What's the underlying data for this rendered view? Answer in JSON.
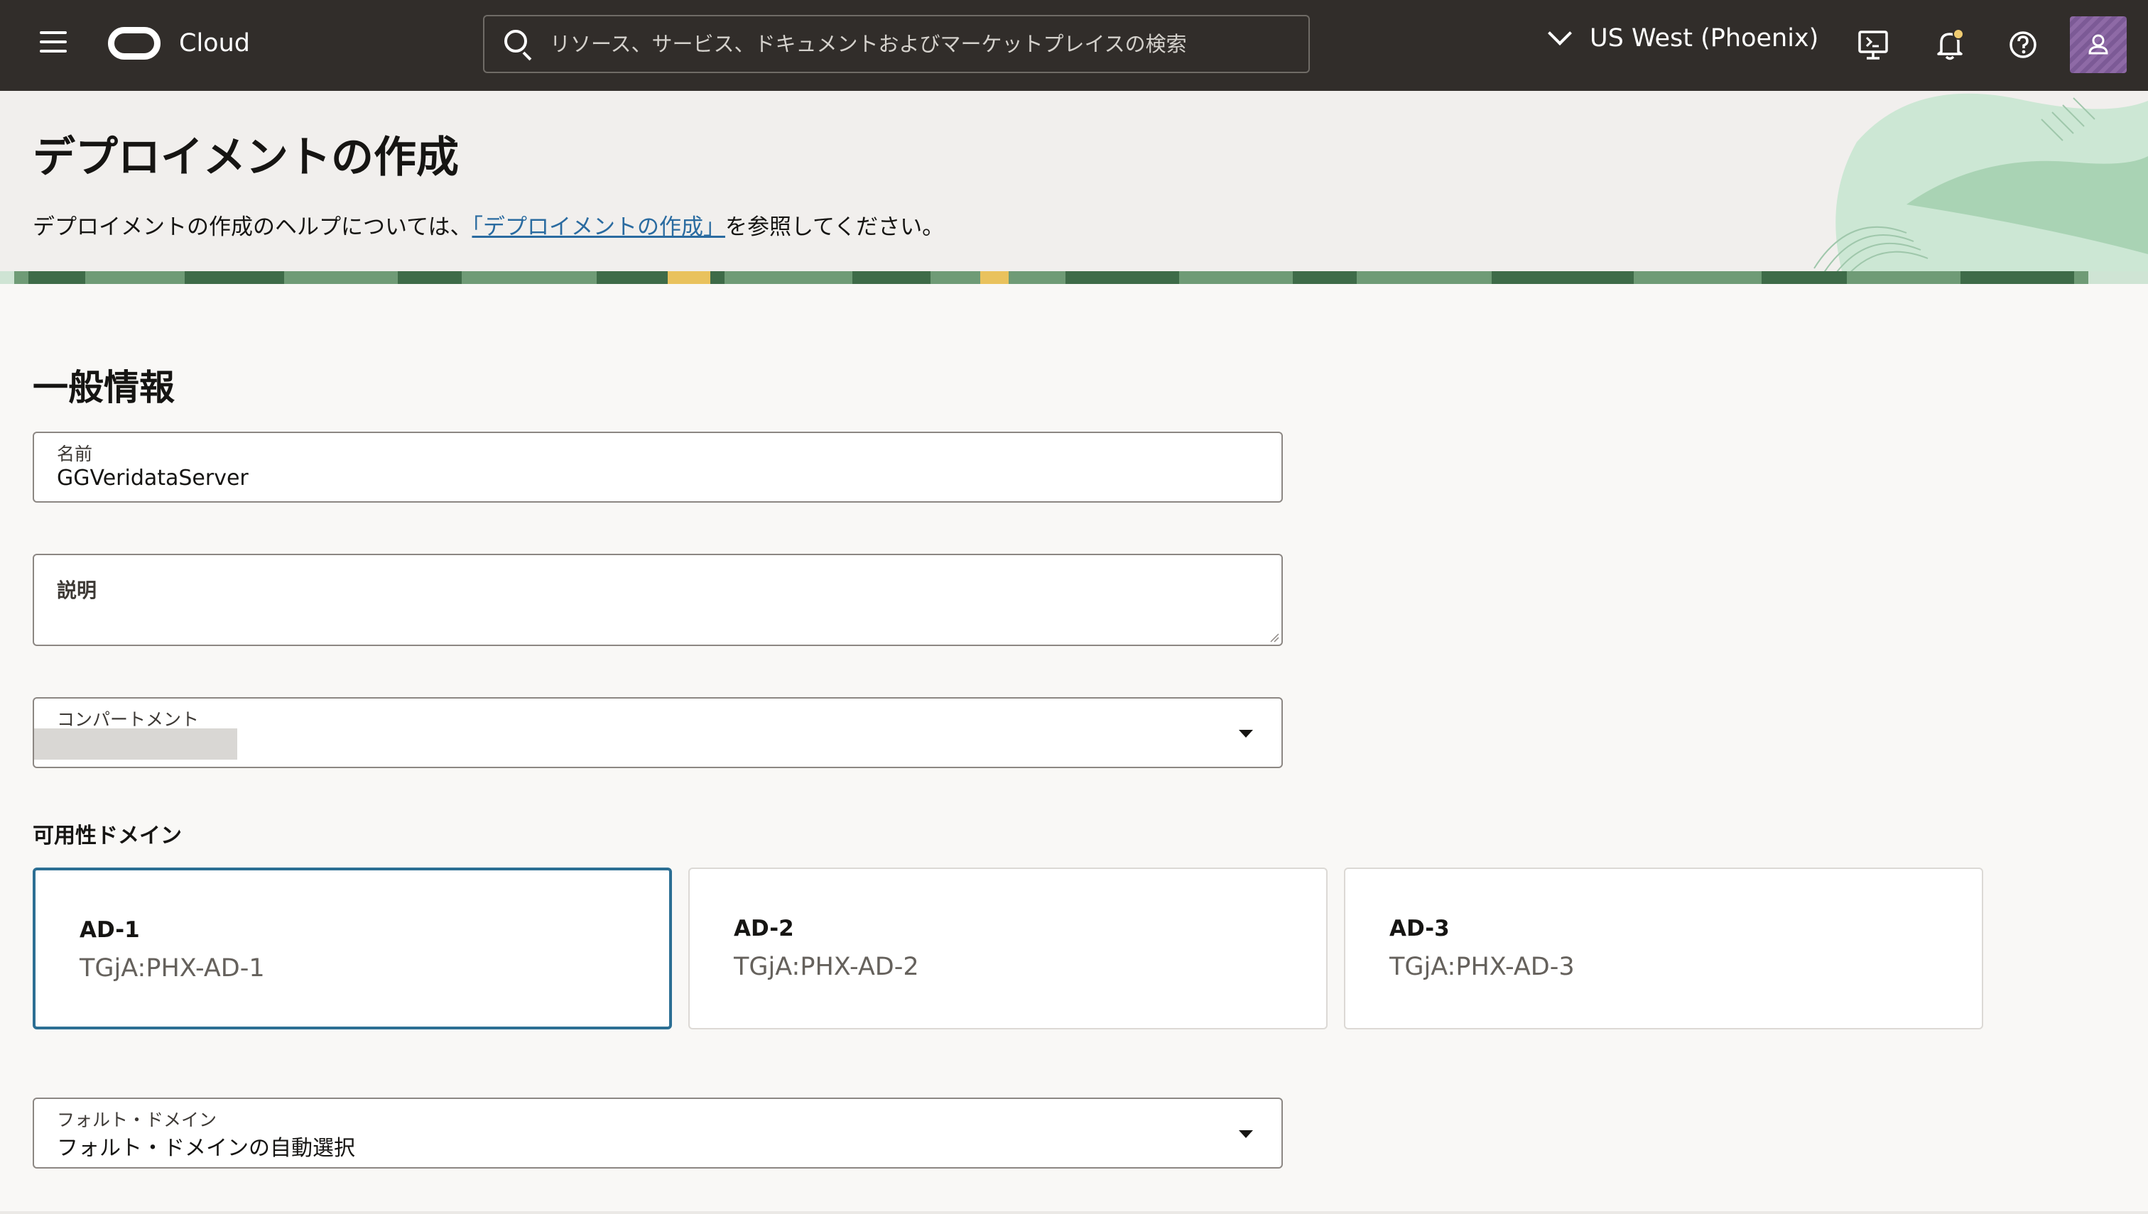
{
  "topbar": {
    "brand": "Cloud",
    "search_placeholder": "リソース、サービス、ドキュメントおよびマーケットプレイスの検索",
    "region": "US West (Phoenix)"
  },
  "header": {
    "title": "デプロイメントの作成",
    "help_prefix": "デプロイメントの作成のヘルプについては、",
    "help_link": "「デプロイメントの作成」",
    "help_suffix": "を参照してください。"
  },
  "form": {
    "section_title": "一般情報",
    "name": {
      "label": "名前",
      "value": "GGVeridataServer"
    },
    "description": {
      "label": "説明",
      "value": ""
    },
    "compartment": {
      "label": "コンパートメント"
    },
    "availability_domain": {
      "label": "可用性ドメイン",
      "options": [
        {
          "name": "AD-1",
          "id": "TGjA:PHX-AD-1",
          "selected": true
        },
        {
          "name": "AD-2",
          "id": "TGjA:PHX-AD-2",
          "selected": false
        },
        {
          "name": "AD-3",
          "id": "TGjA:PHX-AD-3",
          "selected": false
        }
      ]
    },
    "fault_domain": {
      "label": "フォルト・ドメイン",
      "value": "フォルト・ドメインの自動選択"
    }
  },
  "colors": {
    "topbar_bg": "#312d2a",
    "page_bg": "#f9f8f6",
    "header_bg": "#f1efed",
    "link": "#2a6ba0",
    "selected_border": "#2c6f94",
    "accent_green": "#a9d3b4"
  },
  "icons": [
    "hamburger-menu-icon",
    "oracle-logo",
    "search-icon",
    "chevron-down-icon",
    "cloud-shell-icon",
    "bell-icon",
    "help-icon",
    "user-icon",
    "dropdown-caret-icon"
  ]
}
